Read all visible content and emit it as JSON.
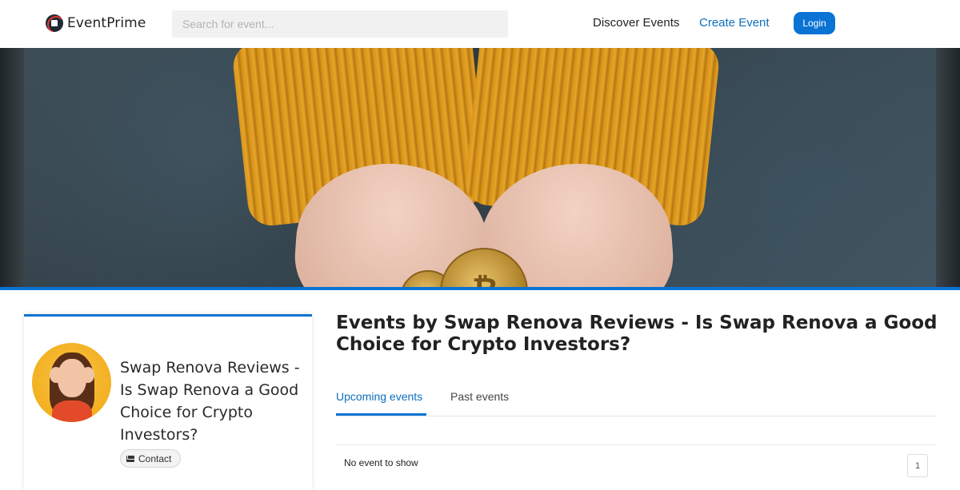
{
  "header": {
    "logo_text": "EventPrime",
    "search_placeholder": "Search for event...",
    "nav": {
      "discover_label": "Discover Events",
      "create_label": "Create Event",
      "login_label": "Login"
    }
  },
  "hero": {
    "image": "hands-holding-bitcoin-coins-orange-sweater"
  },
  "profile": {
    "avatar": "woman-holding-coins-avatar",
    "title": "Swap Renova Reviews - Is Swap Renova a Good Choice for Crypto Investors?",
    "contact_label": "Contact",
    "contact_icon": "mail-icon"
  },
  "main": {
    "title": "Events by Swap Renova Reviews - Is Swap Renova a Good Choice for Crypto Investors?",
    "tabs": [
      {
        "label": "Upcoming events",
        "active": true
      },
      {
        "label": "Past events",
        "active": false
      }
    ],
    "empty_message": "No event to show",
    "pagination": {
      "current_page": "1"
    }
  },
  "colors": {
    "accent": "#0a73d4",
    "link": "#0d6fbd"
  }
}
